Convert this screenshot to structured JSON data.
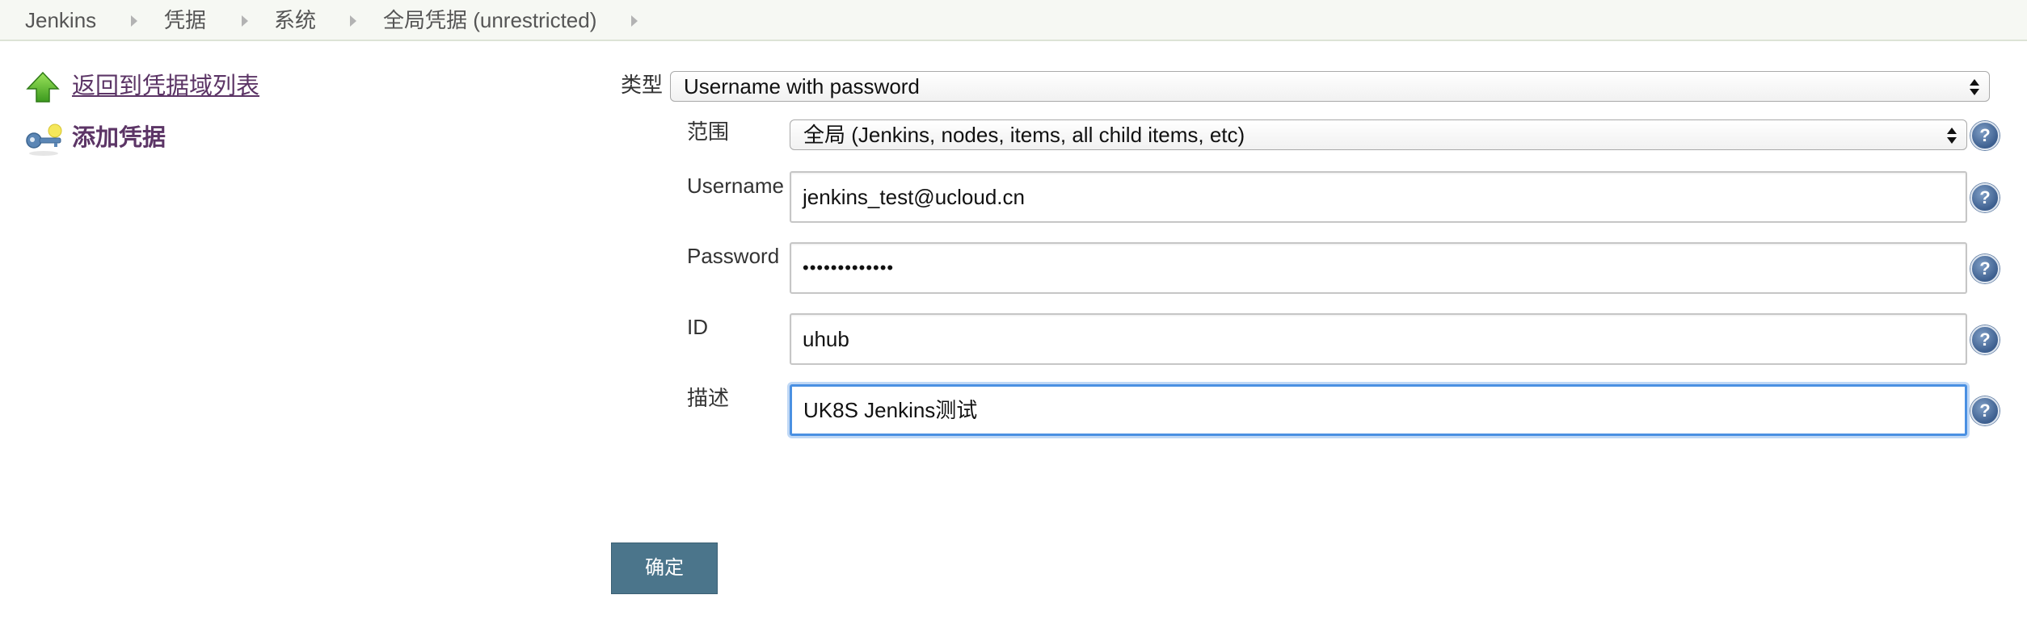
{
  "breadcrumb": {
    "items": [
      {
        "label": "Jenkins"
      },
      {
        "label": "凭据"
      },
      {
        "label": "系统"
      },
      {
        "label": "全局凭据 (unrestricted)"
      }
    ]
  },
  "sidebar": {
    "back_link": "返回到凭据域列表",
    "add_credential": "添加凭据"
  },
  "form": {
    "kind_label": "类型",
    "kind_value": "Username with password",
    "scope_label": "范围",
    "scope_value": "全局 (Jenkins, nodes, items, all child items, etc)",
    "username_label": "Username",
    "username_value": "jenkins_test@ucloud.cn",
    "password_label": "Password",
    "password_value": "•••••••••••••",
    "id_label": "ID",
    "id_value": "uhub",
    "description_label": "描述",
    "description_value": "UK8S Jenkins测试",
    "help_glyph": "?",
    "submit_label": "确定"
  },
  "colors": {
    "link": "#5c3566",
    "submit_button": "#4b758b",
    "focus_ring": "#4a90e2",
    "help_icon": "#3d5f8f"
  }
}
